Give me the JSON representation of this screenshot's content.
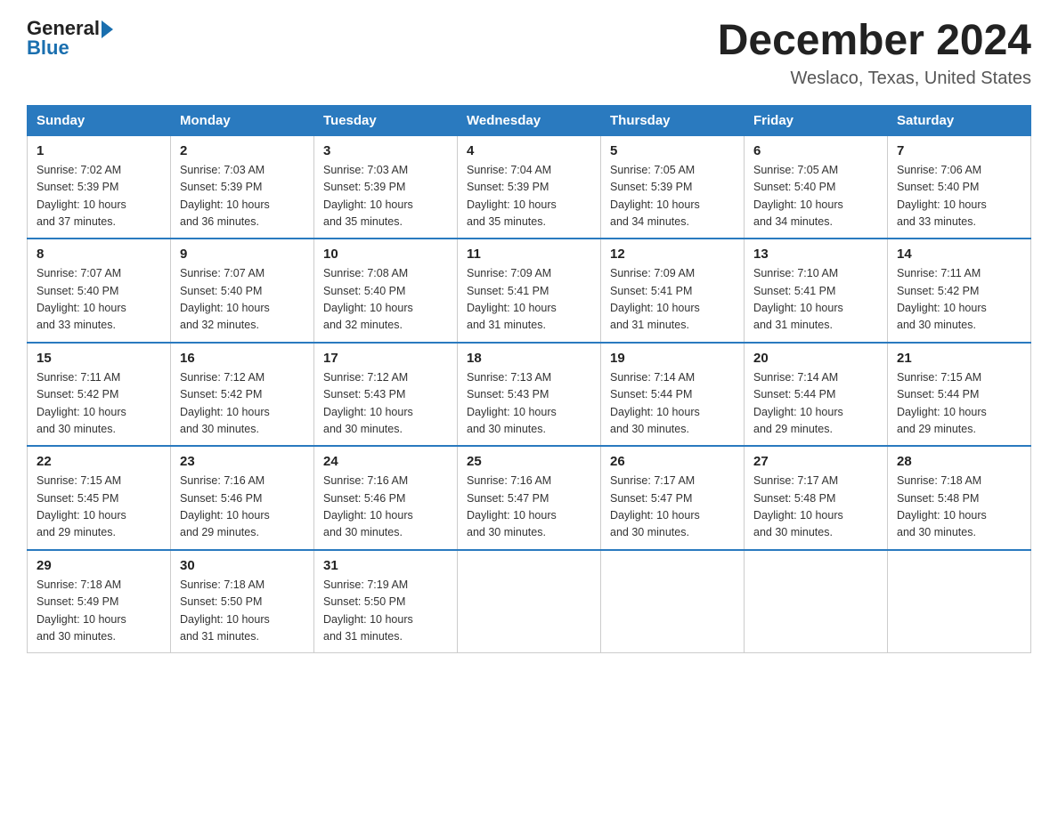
{
  "header": {
    "logo_general": "General",
    "logo_blue": "Blue",
    "title": "December 2024",
    "subtitle": "Weslaco, Texas, United States"
  },
  "days_of_week": [
    "Sunday",
    "Monday",
    "Tuesday",
    "Wednesday",
    "Thursday",
    "Friday",
    "Saturday"
  ],
  "weeks": [
    [
      {
        "day": "1",
        "sunrise": "7:02 AM",
        "sunset": "5:39 PM",
        "daylight": "10 hours and 37 minutes."
      },
      {
        "day": "2",
        "sunrise": "7:03 AM",
        "sunset": "5:39 PM",
        "daylight": "10 hours and 36 minutes."
      },
      {
        "day": "3",
        "sunrise": "7:03 AM",
        "sunset": "5:39 PM",
        "daylight": "10 hours and 35 minutes."
      },
      {
        "day": "4",
        "sunrise": "7:04 AM",
        "sunset": "5:39 PM",
        "daylight": "10 hours and 35 minutes."
      },
      {
        "day": "5",
        "sunrise": "7:05 AM",
        "sunset": "5:39 PM",
        "daylight": "10 hours and 34 minutes."
      },
      {
        "day": "6",
        "sunrise": "7:05 AM",
        "sunset": "5:40 PM",
        "daylight": "10 hours and 34 minutes."
      },
      {
        "day": "7",
        "sunrise": "7:06 AM",
        "sunset": "5:40 PM",
        "daylight": "10 hours and 33 minutes."
      }
    ],
    [
      {
        "day": "8",
        "sunrise": "7:07 AM",
        "sunset": "5:40 PM",
        "daylight": "10 hours and 33 minutes."
      },
      {
        "day": "9",
        "sunrise": "7:07 AM",
        "sunset": "5:40 PM",
        "daylight": "10 hours and 32 minutes."
      },
      {
        "day": "10",
        "sunrise": "7:08 AM",
        "sunset": "5:40 PM",
        "daylight": "10 hours and 32 minutes."
      },
      {
        "day": "11",
        "sunrise": "7:09 AM",
        "sunset": "5:41 PM",
        "daylight": "10 hours and 31 minutes."
      },
      {
        "day": "12",
        "sunrise": "7:09 AM",
        "sunset": "5:41 PM",
        "daylight": "10 hours and 31 minutes."
      },
      {
        "day": "13",
        "sunrise": "7:10 AM",
        "sunset": "5:41 PM",
        "daylight": "10 hours and 31 minutes."
      },
      {
        "day": "14",
        "sunrise": "7:11 AM",
        "sunset": "5:42 PM",
        "daylight": "10 hours and 30 minutes."
      }
    ],
    [
      {
        "day": "15",
        "sunrise": "7:11 AM",
        "sunset": "5:42 PM",
        "daylight": "10 hours and 30 minutes."
      },
      {
        "day": "16",
        "sunrise": "7:12 AM",
        "sunset": "5:42 PM",
        "daylight": "10 hours and 30 minutes."
      },
      {
        "day": "17",
        "sunrise": "7:12 AM",
        "sunset": "5:43 PM",
        "daylight": "10 hours and 30 minutes."
      },
      {
        "day": "18",
        "sunrise": "7:13 AM",
        "sunset": "5:43 PM",
        "daylight": "10 hours and 30 minutes."
      },
      {
        "day": "19",
        "sunrise": "7:14 AM",
        "sunset": "5:44 PM",
        "daylight": "10 hours and 30 minutes."
      },
      {
        "day": "20",
        "sunrise": "7:14 AM",
        "sunset": "5:44 PM",
        "daylight": "10 hours and 29 minutes."
      },
      {
        "day": "21",
        "sunrise": "7:15 AM",
        "sunset": "5:44 PM",
        "daylight": "10 hours and 29 minutes."
      }
    ],
    [
      {
        "day": "22",
        "sunrise": "7:15 AM",
        "sunset": "5:45 PM",
        "daylight": "10 hours and 29 minutes."
      },
      {
        "day": "23",
        "sunrise": "7:16 AM",
        "sunset": "5:46 PM",
        "daylight": "10 hours and 29 minutes."
      },
      {
        "day": "24",
        "sunrise": "7:16 AM",
        "sunset": "5:46 PM",
        "daylight": "10 hours and 30 minutes."
      },
      {
        "day": "25",
        "sunrise": "7:16 AM",
        "sunset": "5:47 PM",
        "daylight": "10 hours and 30 minutes."
      },
      {
        "day": "26",
        "sunrise": "7:17 AM",
        "sunset": "5:47 PM",
        "daylight": "10 hours and 30 minutes."
      },
      {
        "day": "27",
        "sunrise": "7:17 AM",
        "sunset": "5:48 PM",
        "daylight": "10 hours and 30 minutes."
      },
      {
        "day": "28",
        "sunrise": "7:18 AM",
        "sunset": "5:48 PM",
        "daylight": "10 hours and 30 minutes."
      }
    ],
    [
      {
        "day": "29",
        "sunrise": "7:18 AM",
        "sunset": "5:49 PM",
        "daylight": "10 hours and 30 minutes."
      },
      {
        "day": "30",
        "sunrise": "7:18 AM",
        "sunset": "5:50 PM",
        "daylight": "10 hours and 31 minutes."
      },
      {
        "day": "31",
        "sunrise": "7:19 AM",
        "sunset": "5:50 PM",
        "daylight": "10 hours and 31 minutes."
      },
      null,
      null,
      null,
      null
    ]
  ],
  "labels": {
    "sunrise": "Sunrise:",
    "sunset": "Sunset:",
    "daylight": "Daylight:"
  }
}
